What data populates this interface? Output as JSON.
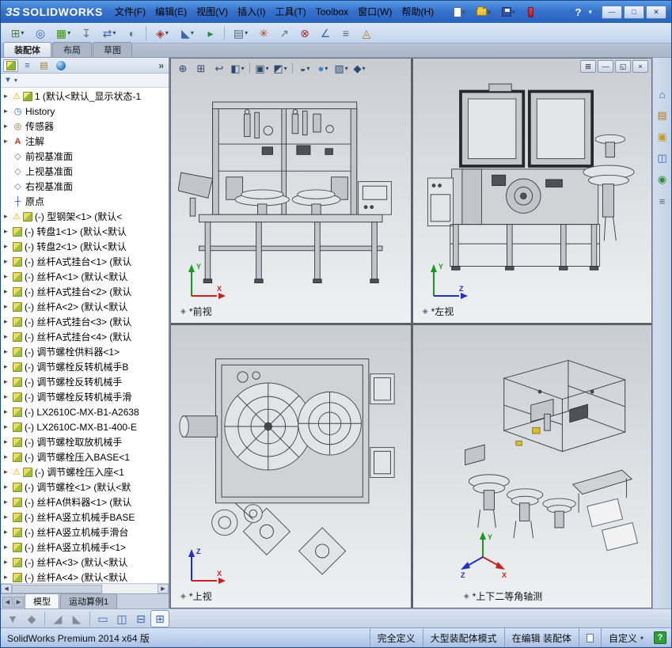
{
  "colors": {
    "axis_x": "#cc2020",
    "axis_y": "#1a9a1a",
    "axis_z": "#2030cc",
    "titlebar_blue": "#3672cc",
    "warning_yellow": "#e8a800",
    "help_green": "#2f9e38"
  },
  "titlebar": {
    "logo_mark": "3S",
    "brand": "SOLIDWORKS",
    "menus": [
      "文件(F)",
      "编辑(E)",
      "视图(V)",
      "插入(I)",
      "工具(T)",
      "Toolbox",
      "窗口(W)",
      "帮助(H)"
    ],
    "help": "?",
    "window_buttons": {
      "minimize": "—",
      "maximize": "□",
      "close": "✕"
    }
  },
  "quick_access": [
    {
      "name": "new-document-icon",
      "icon": "page",
      "dd": true
    },
    {
      "name": "open-document-icon",
      "icon": "folder",
      "dd": true
    },
    {
      "name": "save-document-icon",
      "icon": "save",
      "dd": true
    },
    {
      "name": "rebuild-icon",
      "icon": "rebuild"
    }
  ],
  "assembly_toolbar": [
    {
      "name": "insert-components-icon",
      "glyph": "⊞",
      "color": "#4a8c2c",
      "dd": true
    },
    {
      "name": "mate-icon",
      "glyph": "◎",
      "color": "#3a64b0"
    },
    {
      "name": "linear-component-pattern-icon",
      "glyph": "▦",
      "color": "#4a8c2c",
      "dd": true
    },
    {
      "name": "smart-fasteners-icon",
      "glyph": "↧",
      "color": "#6a7480"
    },
    {
      "name": "move-component-icon",
      "glyph": "⇄",
      "color": "#3a64b0",
      "dd": true
    },
    {
      "name": "show-hidden-components-icon",
      "glyph": "◐",
      "color": "#6a7480"
    },
    {
      "sep": true
    },
    {
      "name": "assembly-features-icon",
      "glyph": "◈",
      "color": "#a04028",
      "dd": true
    },
    {
      "name": "reference-geometry-icon",
      "glyph": "◣",
      "color": "#3a64b0",
      "dd": true
    },
    {
      "name": "new-motion-study-icon",
      "glyph": "▸",
      "color": "#2c8c3c"
    },
    {
      "sep": true
    },
    {
      "name": "bill-of-materials-icon",
      "glyph": "▤",
      "color": "#5c6878",
      "dd": true
    },
    {
      "name": "exploded-view-icon",
      "glyph": "✳",
      "color": "#b04828"
    },
    {
      "name": "explode-line-sketch-icon",
      "glyph": "↗",
      "color": "#6a7480"
    },
    {
      "name": "interference-detection-icon",
      "glyph": "⊗",
      "color": "#a03030"
    },
    {
      "name": "measure-icon",
      "glyph": "∠",
      "color": "#3a64b0"
    },
    {
      "name": "mass-properties-icon",
      "glyph": "≡",
      "color": "#5c6878"
    },
    {
      "name": "instant3d-icon",
      "glyph": "◬",
      "color": "#b08020"
    }
  ],
  "command_tabs": [
    {
      "label": "装配体",
      "active": true
    },
    {
      "label": "布局"
    },
    {
      "label": "草图"
    }
  ],
  "feature_tree": {
    "items": [
      {
        "name": "tree-item-assembly-root",
        "text": "1 (默认<默认_显示状态-1",
        "icon": "assembly",
        "warning": true,
        "expand": true
      },
      {
        "name": "tree-item-history",
        "text": "History",
        "icon": "history",
        "expand": true
      },
      {
        "name": "tree-item-sensors",
        "text": "传感器",
        "icon": "sensors",
        "expand": true
      },
      {
        "name": "tree-item-annotations",
        "text": "注解",
        "icon": "annotations",
        "expand": true
      },
      {
        "name": "tree-item-front-plane",
        "text": "前视基准面",
        "icon": "plane"
      },
      {
        "name": "tree-item-top-plane",
        "text": "上视基准面",
        "icon": "plane"
      },
      {
        "name": "tree-item-right-plane",
        "text": "右视基准面",
        "icon": "plane"
      },
      {
        "name": "tree-item-origin",
        "text": "原点",
        "icon": "origin"
      },
      {
        "text": "(-) 型钢架<1> (默认<",
        "icon": "component",
        "warning": true,
        "expand": true
      },
      {
        "text": "(-) 转盘1<1> (默认<默认",
        "icon": "component",
        "expand": true
      },
      {
        "text": "(-) 转盘2<1> (默认<默认",
        "icon": "component",
        "expand": true
      },
      {
        "text": "(-) 丝杆A式挂台<1> (默认",
        "icon": "component",
        "expand": true
      },
      {
        "text": "(-) 丝杆A<1> (默认<默认",
        "icon": "component",
        "expand": true
      },
      {
        "text": "(-) 丝杆A式挂台<2> (默认",
        "icon": "component",
        "expand": true
      },
      {
        "text": "(-) 丝杆A<2> (默认<默认",
        "icon": "component",
        "expand": true
      },
      {
        "text": "(-) 丝杆A式挂台<3> (默认",
        "icon": "component",
        "expand": true
      },
      {
        "text": "(-) 丝杆A式挂台<4> (默认",
        "icon": "component",
        "expand": true
      },
      {
        "text": "(-) 调节螺栓供料器<1>",
        "icon": "component",
        "expand": true
      },
      {
        "text": "(-) 调节螺栓反转机械手B",
        "icon": "component",
        "expand": true
      },
      {
        "text": "(-) 调节螺栓反转机械手",
        "icon": "component",
        "expand": true
      },
      {
        "text": "(-) 调节螺栓反转机械手滑",
        "icon": "component",
        "expand": true
      },
      {
        "text": "(-) LX2610C-MX-B1-A2638",
        "icon": "component",
        "expand": true
      },
      {
        "text": "(-) LX2610C-MX-B1-400-E",
        "icon": "component",
        "expand": true
      },
      {
        "text": "(-) 调节螺栓取放机械手",
        "icon": "component",
        "expand": true
      },
      {
        "text": "(-) 调节螺栓压入BASE<1",
        "icon": "component",
        "expand": true
      },
      {
        "text": "(-) 调节螺栓压入座<1",
        "icon": "component",
        "warning": true,
        "expand": true
      },
      {
        "text": "(-) 调节螺栓<1> (默认<默",
        "icon": "component",
        "expand": true
      },
      {
        "text": "(-) 丝杆A供料器<1> (默认",
        "icon": "component",
        "expand": true
      },
      {
        "text": "(-) 丝杆A竖立机械手BASE",
        "icon": "component",
        "expand": true
      },
      {
        "text": "(-) 丝杆A竖立机械手滑台",
        "icon": "component",
        "expand": true
      },
      {
        "text": "(-) 丝杆A竖立机械手<1>",
        "icon": "component",
        "expand": true
      },
      {
        "text": "(-) 丝杆A<3> (默认<默认",
        "icon": "component",
        "expand": true
      },
      {
        "text": "(-) 丝杆A<4> (默认<默认",
        "icon": "component",
        "expand": true
      }
    ]
  },
  "panel_bottom_tabs": [
    {
      "label": "模型",
      "active": true
    },
    {
      "label": "运动算例1"
    }
  ],
  "viewport": {
    "views": [
      {
        "label": "*前视",
        "axes": {
          "up": "Y",
          "right": "X"
        }
      },
      {
        "label": "*左视",
        "axes": {
          "up": "Y",
          "right": "Z"
        }
      },
      {
        "label": "*上视",
        "axes": {
          "up": "Z",
          "right": "X"
        }
      },
      {
        "label": "*上下二等角轴测",
        "axes": {
          "up": "Y",
          "right": "X",
          "left": "Z"
        }
      }
    ],
    "headsup": [
      {
        "name": "zoom-to-fit-icon",
        "glyph": "⊕"
      },
      {
        "name": "zoom-to-area-icon",
        "glyph": "⊞"
      },
      {
        "name": "previous-view-icon",
        "glyph": "↩"
      },
      {
        "name": "section-view-icon",
        "glyph": "◧",
        "dd": true
      },
      {
        "sep": true
      },
      {
        "name": "view-orientation-icon",
        "glyph": "▣",
        "dd": true
      },
      {
        "name": "display-style-icon",
        "glyph": "◩",
        "dd": true
      },
      {
        "sep": true
      },
      {
        "name": "hide-show-items-icon",
        "glyph": "◒",
        "dd": true
      },
      {
        "name": "edit-appearance-icon",
        "glyph": "●",
        "color": "#3a8cc8",
        "dd": true
      },
      {
        "name": "apply-scene-icon",
        "glyph": "▨",
        "dd": true
      },
      {
        "name": "view-settings-icon",
        "glyph": "◆",
        "dd": true
      }
    ],
    "window_controls": [
      {
        "name": "viewport-link-button",
        "glyph": "⊞"
      },
      {
        "name": "document-minimize-button",
        "glyph": "—"
      },
      {
        "name": "document-restore-button",
        "glyph": "◱"
      },
      {
        "name": "document-close-button",
        "glyph": "×"
      }
    ]
  },
  "task_pane": [
    {
      "name": "solidworks-resources-icon",
      "glyph": "⌂",
      "color": "#2c64b0"
    },
    {
      "name": "design-library-icon",
      "glyph": "▤",
      "color": "#b07c20"
    },
    {
      "name": "file-explorer-icon",
      "glyph": "▣",
      "color": "#c89830"
    },
    {
      "name": "view-palette-icon",
      "glyph": "◫",
      "color": "#3a64b0"
    },
    {
      "name": "appearances-scenes-icon",
      "glyph": "◉",
      "color": "#2c9040"
    },
    {
      "name": "custom-properties-icon",
      "glyph": "≡",
      "color": "#5c6878"
    }
  ],
  "bottom_toolbar": [
    {
      "name": "selection-filter-toggle-icon",
      "glyph": "▼",
      "disabled": true
    },
    {
      "name": "filter-vertices-icon",
      "glyph": "◆",
      "disabled": true
    },
    {
      "sep": true
    },
    {
      "name": "filter-edges-icon",
      "glyph": "◢",
      "disabled": true
    },
    {
      "name": "filter-faces-icon",
      "glyph": "◣",
      "disabled": true
    },
    {
      "sep": true
    },
    {
      "name": "single-view-icon",
      "glyph": "▭",
      "color": "#3a64b0"
    },
    {
      "name": "two-view-vertical-icon",
      "glyph": "◫",
      "color": "#3a64b0"
    },
    {
      "name": "two-view-horizontal-icon",
      "glyph": "⊟",
      "color": "#3a64b0"
    },
    {
      "name": "four-view-icon",
      "glyph": "⊞",
      "color": "#3a64b0",
      "active": true
    }
  ],
  "statusbar": {
    "left": "SolidWorks Premium 2014 x64 版",
    "defined": "完全定义",
    "mode": "大型装配体模式",
    "editing": "在编辑 装配体",
    "units": "自定义",
    "help": "?"
  }
}
